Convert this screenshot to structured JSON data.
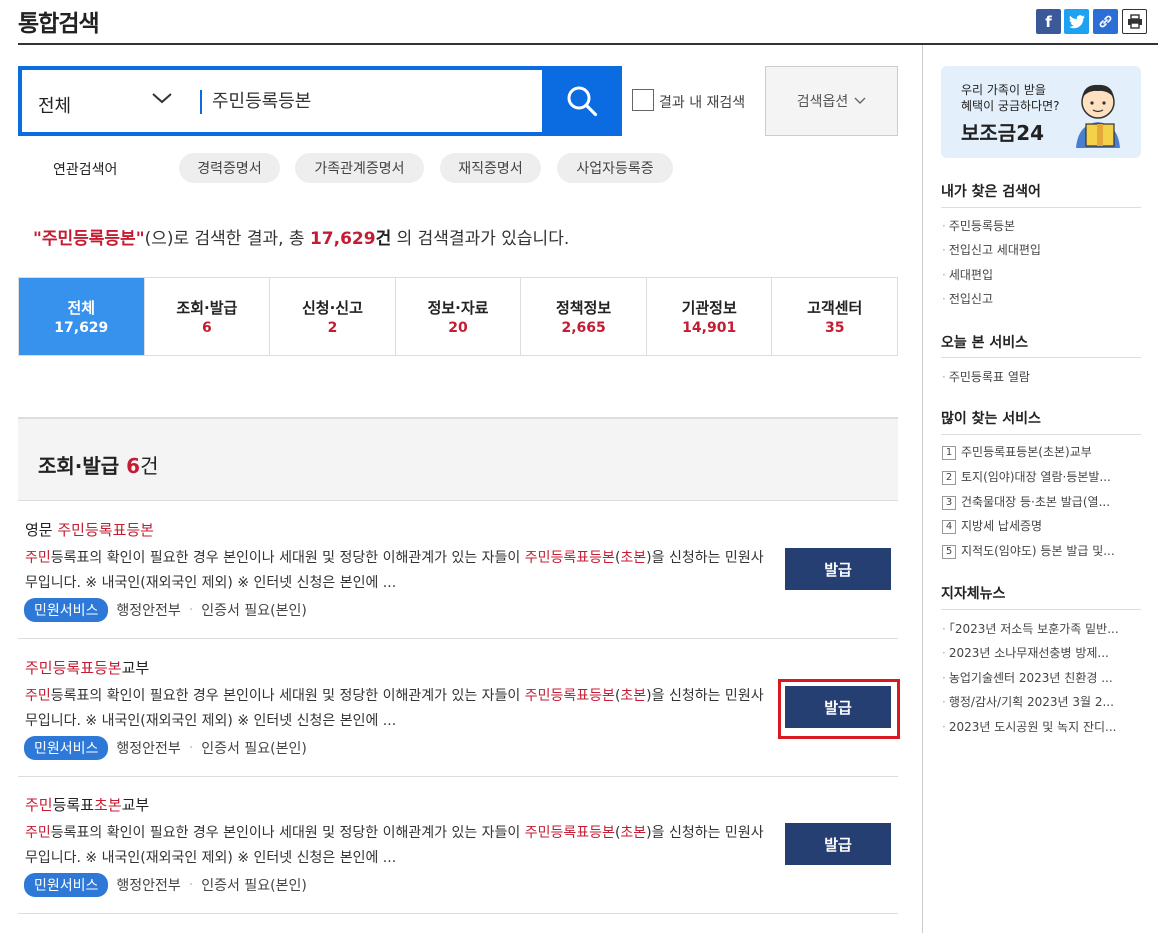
{
  "page": {
    "title": "통합검색"
  },
  "search": {
    "scope": "전체",
    "query": "주민등록등본",
    "research_label": "결과 내 재검색",
    "options_label": "검색옵션"
  },
  "related": {
    "label": "연관검색어",
    "items": [
      "경력증명서",
      "가족관계증명서",
      "재직증명서",
      "사업자등록증"
    ]
  },
  "summary": {
    "keyword": "\"주민등록등본\"",
    "text1": "(으)로 검색한 결과, 총 ",
    "count": "17,629",
    "unit": "건",
    "text2": " 의 검색결과가 있습니다."
  },
  "tabs": [
    {
      "label": "전체",
      "count": "17,629"
    },
    {
      "label": "조회·발급",
      "count": "6"
    },
    {
      "label": "신청·신고",
      "count": "2"
    },
    {
      "label": "정보·자료",
      "count": "20"
    },
    {
      "label": "정책정보",
      "count": "2,665"
    },
    {
      "label": "기관정보",
      "count": "14,901"
    },
    {
      "label": "고객센터",
      "count": "35"
    }
  ],
  "section": {
    "title": "조회·발급",
    "count": "6",
    "unit": "건"
  },
  "results": [
    {
      "title_plain_prefix": "영문 ",
      "title_hl1": "주민등록표등본",
      "title_plain_mid": "",
      "title_hl2": "",
      "title_suffix": "",
      "desc_hl1": "주민",
      "desc_a": "등록표의 확인이 필요한 경우 본인이나 세대원 및 정당한 이해관계가 있는 자들이 ",
      "desc_hl2": "주민등록표등본",
      "desc_b": "(",
      "desc_hl3": "초본",
      "desc_c": ")을 신청하는 민원사무입니다. ※ 내국인(재외국인 제외) ※ 인터넷 신청은 본인에 ...",
      "badge": "민원서비스",
      "agency": "행정안전부",
      "cert": "인증서 필요(본인)",
      "button": "발급"
    },
    {
      "title_plain_prefix": "",
      "title_hl1": "주민등록표등본",
      "title_plain_mid": "",
      "title_hl2": "",
      "title_suffix": "교부",
      "desc_hl1": "주민",
      "desc_a": "등록표의 확인이 필요한 경우 본인이나 세대원 및 정당한 이해관계가 있는 자들이 ",
      "desc_hl2": "주민등록표등본",
      "desc_b": "(",
      "desc_hl3": "초본",
      "desc_c": ")을 신청하는 민원사무입니다. ※ 내국인(재외국인 제외) ※ 인터넷 신청은 본인에 ...",
      "badge": "민원서비스",
      "agency": "행정안전부",
      "cert": "인증서 필요(본인)",
      "button": "발급"
    },
    {
      "title_plain_prefix": "",
      "title_hl1": "주민",
      "title_plain_mid": "등록표",
      "title_hl2": "초본",
      "title_suffix": "교부",
      "desc_hl1": "주민",
      "desc_a": "등록표의 확인이 필요한 경우 본인이나 세대원 및 정당한 이해관계가 있는 자들이 ",
      "desc_hl2": "주민등록표등본",
      "desc_b": "(",
      "desc_hl3": "초본",
      "desc_c": ")을 신청하는 민원사무입니다. ※ 내국인(재외국인 제외) ※ 인터넷 신청은 본인에 ...",
      "badge": "민원서비스",
      "agency": "행정안전부",
      "cert": "인증서 필요(본인)",
      "button": "발급"
    }
  ],
  "banner": {
    "line1": "우리 가족이 받을",
    "line2": "혜택이 궁금하다면?",
    "brand": "보조금24"
  },
  "sidebar": {
    "my_searches": {
      "title": "내가 찾은 검색어",
      "items": [
        "주민등록등본",
        "전입신고 세대편입",
        "세대편입",
        "전입신고"
      ]
    },
    "today": {
      "title": "오늘 본 서비스",
      "items": [
        "주민등록표 열람"
      ]
    },
    "popular": {
      "title": "많이 찾는 서비스",
      "items": [
        {
          "rank": "1",
          "label": "주민등록표등본(초본)교부"
        },
        {
          "rank": "2",
          "label": "토지(임야)대장 열람·등본발..."
        },
        {
          "rank": "3",
          "label": "건축물대장 등·초본 발급(열..."
        },
        {
          "rank": "4",
          "label": "지방세 납세증명"
        },
        {
          "rank": "5",
          "label": "지적도(임야도) 등본 발급 및..."
        }
      ]
    },
    "news": {
      "title": "지자체뉴스",
      "items": [
        "「2023년 저소득 보훈가족 밑반...",
        "2023년 소나무재선충병 방제...",
        "농업기술센터 2023년 친환경 ...",
        "행정/감사/기획 2023년 3월 2...",
        "2023년 도시공원 및 녹지 잔디..."
      ]
    }
  },
  "colors": {
    "accent": "#0b6be0",
    "highlight": "#c41c32",
    "button": "#263f72",
    "active_tab": "#3792ed",
    "outline": "#d71921"
  }
}
